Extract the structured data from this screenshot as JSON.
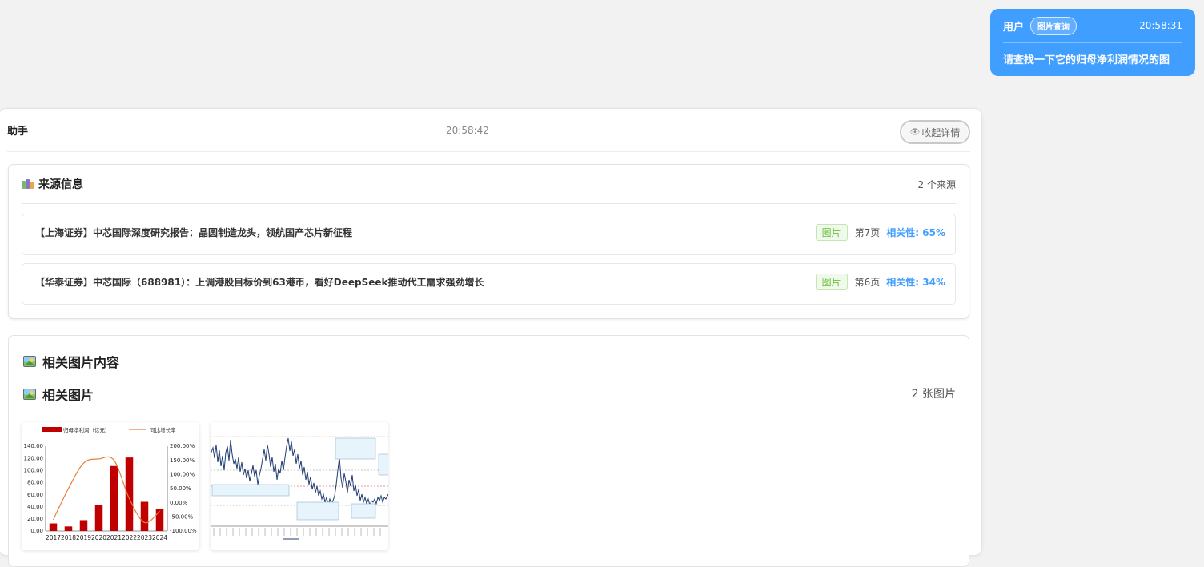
{
  "user_msg": {
    "name": "用户",
    "tag": "图片查询",
    "time": "20:58:31",
    "text": "请查找一下它的归母净利润情况的图"
  },
  "assistant": {
    "name": "助手",
    "time": "20:58:42",
    "collapse_label": "收起详情",
    "sources": {
      "title": "来源信息",
      "count": "2 个来源",
      "items": [
        {
          "title": "【上海证券】中芯国际深度研究报告：晶圆制造龙头，领航国产芯片新征程",
          "badge": "图片",
          "page": "第7页",
          "relevance": "相关性: 65%"
        },
        {
          "title": "【华泰证券】中芯国际（688981）：上调港股目标价到63港币，看好DeepSeek推动代工需求强劲增长",
          "badge": "图片",
          "page": "第6页",
          "relevance": "相关性: 34%"
        }
      ]
    },
    "images": {
      "section_title": "相关图片内容",
      "subtitle": "相关图片",
      "count": "2 张图片"
    }
  },
  "chart_data": [
    {
      "type": "bar",
      "title": "",
      "categories": [
        "2017",
        "2018",
        "2019",
        "2020",
        "2021",
        "2022",
        "2023",
        "2024"
      ],
      "series": [
        {
          "name": "归母净利润（亿元）",
          "type": "bar",
          "axis": "left",
          "color": "#c00000",
          "values": [
            12.5,
            7.5,
            17.9,
            43.3,
            107.3,
            121.3,
            48.2,
            37.0
          ]
        },
        {
          "name": "同比增长率",
          "type": "line",
          "axis": "right",
          "color": "#e8803a",
          "values_pct": [
            -60,
            50,
            140,
            155,
            150,
            15,
            -70,
            -30
          ]
        }
      ],
      "ylim_left": [
        0,
        140
      ],
      "ylim_right": [
        -100,
        200
      ],
      "y_ticks_left": [
        "0.00",
        "20.00",
        "40.00",
        "60.00",
        "80.00",
        "100.00",
        "120.00",
        "140.00"
      ],
      "y_ticks_right": [
        "-100.00%",
        "-50.00%",
        "0.00%",
        "50.00%",
        "100.00%",
        "150.00%",
        "200.00%"
      ],
      "legend_position": "top"
    }
  ],
  "colors": {
    "accent": "#409eff",
    "bar": "#c00000",
    "line": "#e8803a",
    "stock_line": "#1f3b6e"
  }
}
